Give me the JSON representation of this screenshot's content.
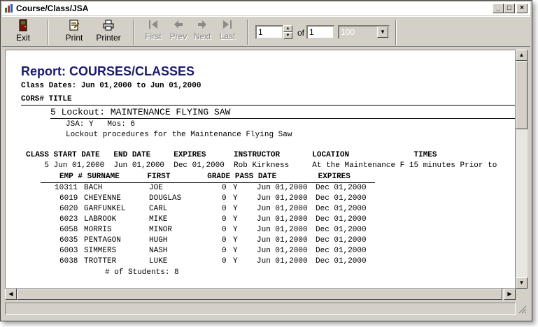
{
  "window": {
    "title": "Course/Class/JSA",
    "min": "_",
    "max": "□",
    "close": "×"
  },
  "toolbar": {
    "exit": "Exit",
    "print": "Print",
    "printer": "Printer",
    "first": "First",
    "prev": "Prev",
    "next": "Next",
    "last": "Last",
    "page_current": "1",
    "of_label": "of",
    "page_total": "1",
    "zoom": "100"
  },
  "report": {
    "title": "Report: COURSES/CLASSES",
    "class_dates": "Class Dates: Jun 01,2000 to Jun 01,2000",
    "course_header": "CORS# TITLE",
    "course_line": "5 Lockout: MAINTENANCE FLYING SAW",
    "jsa_line": "JSA: Y   Mos: 6",
    "description": "Lockout procedures for the Maintenance Flying Saw",
    "class_header": "CLASS START DATE   END DATE     EXPIRES      INSTRUCTOR       LOCATION              TIMES",
    "class_row": "    5 Jun 01,2000  Jun 01,2000  Dec 01,2000  Rob Kirkness     At the Maintenance F 15 minutes Prior to",
    "student_header": "EMP # SURNAME      FIRST        GRADE PASS DATE         EXPIRES",
    "students": [
      {
        "emp": "10311",
        "surname": "BACH",
        "first": "JOE",
        "grade": "0",
        "pass": "Y",
        "date": "Jun 01,2000",
        "expires": "Dec 01,2000"
      },
      {
        "emp": "6019",
        "surname": "CHEYENNE",
        "first": "DOUGLAS",
        "grade": "0",
        "pass": "Y",
        "date": "Jun 01,2000",
        "expires": "Dec 01,2000"
      },
      {
        "emp": "6020",
        "surname": "GARFUNKEL",
        "first": "CARL",
        "grade": "0",
        "pass": "Y",
        "date": "Jun 01,2000",
        "expires": "Dec 01,2000"
      },
      {
        "emp": "6023",
        "surname": "LABROOK",
        "first": "MIKE",
        "grade": "0",
        "pass": "Y",
        "date": "Jun 01,2000",
        "expires": "Dec 01,2000"
      },
      {
        "emp": "6058",
        "surname": "MORRIS",
        "first": "MINOR",
        "grade": "0",
        "pass": "Y",
        "date": "Jun 01,2000",
        "expires": "Dec 01,2000"
      },
      {
        "emp": "6035",
        "surname": "PENTAGON",
        "first": "HUGH",
        "grade": "0",
        "pass": "Y",
        "date": "Jun 01,2000",
        "expires": "Dec 01,2000"
      },
      {
        "emp": "6003",
        "surname": "SIMMERS",
        "first": "NASH",
        "grade": "0",
        "pass": "Y",
        "date": "Jun 01,2000",
        "expires": "Dec 01,2000"
      },
      {
        "emp": "6038",
        "surname": "TROTTER",
        "first": "LUKE",
        "grade": "0",
        "pass": "Y",
        "date": "Jun 01,2000",
        "expires": "Dec 01,2000"
      }
    ],
    "student_count": "# of Students: 8"
  }
}
